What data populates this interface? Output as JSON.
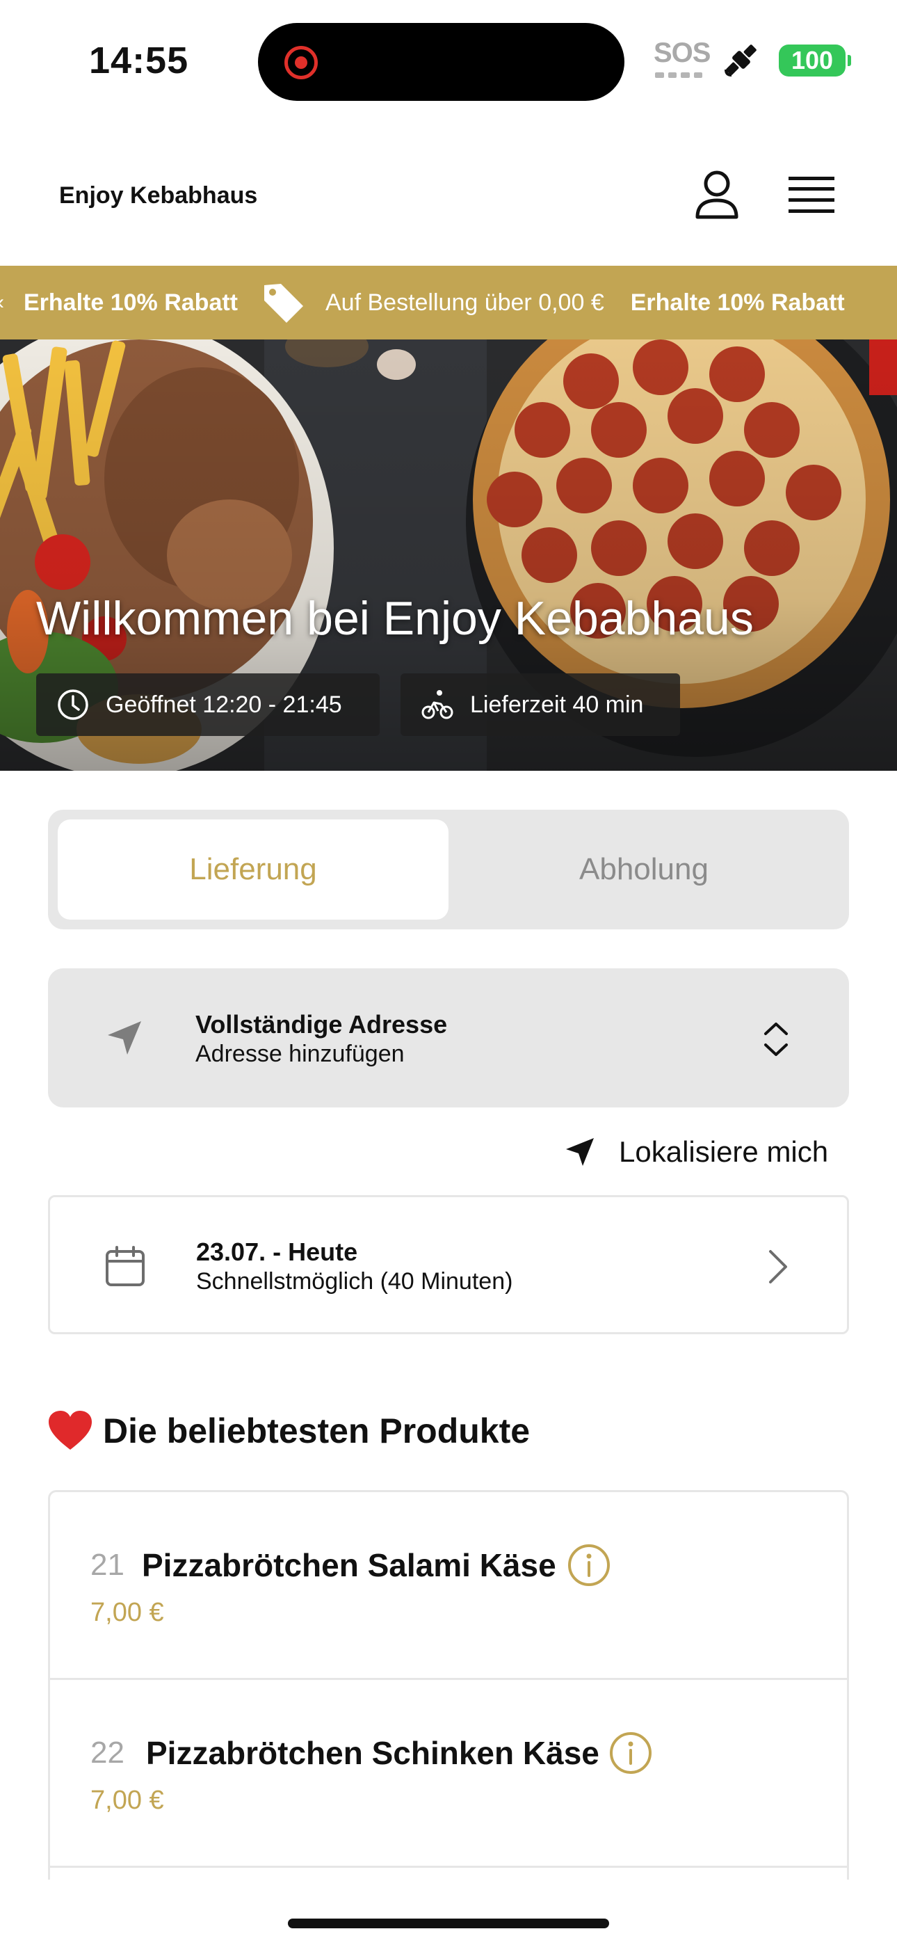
{
  "status_bar": {
    "time": "14:55",
    "sos_label": "SOS",
    "battery": "100"
  },
  "header": {
    "brand": "Enjoy Kebabhaus"
  },
  "promo": {
    "items": [
      "Erhalte 10% Rabatt",
      "Auf Bestellung über 0,00 €",
      "Erhalte 10% Rabatt"
    ],
    "color": "#c2a553"
  },
  "hero": {
    "title": "Willkommen bei Enjoy Kebabhaus",
    "open_hours": "Geöffnet 12:20 - 21:45",
    "delivery_time": "Lieferzeit 40 min"
  },
  "order_type": {
    "options": [
      "Lieferung",
      "Abholung"
    ],
    "selected": "Lieferung"
  },
  "address": {
    "title": "Vollständige Adresse",
    "subtitle": "Adresse hinzufügen",
    "locate_label": "Lokalisiere mich"
  },
  "schedule": {
    "date": "23.07. - Heute",
    "time": "Schnellstmöglich (40 Minuten)"
  },
  "popular": {
    "title": "Die beliebtesten Produkte",
    "icon": "heart-icon",
    "products": [
      {
        "number": "21",
        "name": "Pizzabrötchen Salami Käse",
        "price": "7,00 €"
      },
      {
        "number": "22",
        "name": "Pizzabrötchen Schinken Käse",
        "price": "7,00 €"
      }
    ]
  },
  "colors": {
    "accent": "#c2a553",
    "panel": "#e7e7e7"
  }
}
